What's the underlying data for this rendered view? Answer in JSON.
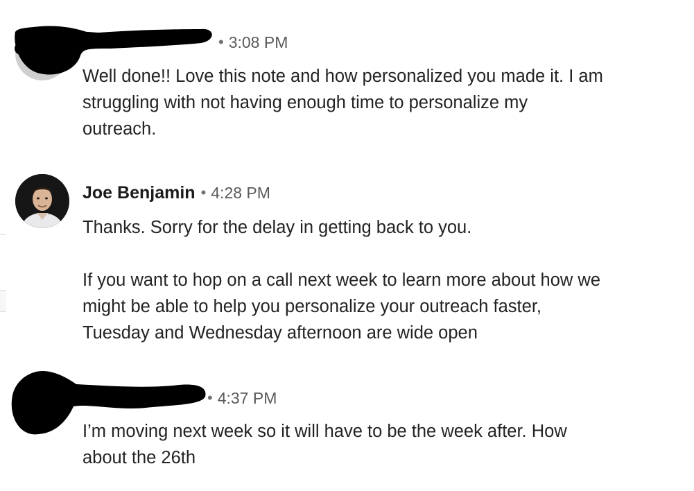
{
  "messages": [
    {
      "sender": "",
      "sender_redacted": true,
      "separator": "•",
      "time": "3:08 PM",
      "text": "Well done!! Love this note and how personalized you made it. I am\nstruggling with not having enough time to personalize my\noutreach."
    },
    {
      "sender": "Joe Benjamin",
      "sender_redacted": false,
      "separator": "•",
      "time": "4:28 PM",
      "text": "Thanks. Sorry for the delay in getting back to you.\n\nIf you want to hop on a call next week to learn more about how we\nmight be able to help you personalize your outreach faster,\nTuesday and Wednesday afternoon are wide open"
    },
    {
      "sender": "",
      "sender_redacted": true,
      "separator": "•",
      "time": "4:37 PM",
      "text": "I’m moving next week so it will have to be the week after. How\nabout the 26th"
    }
  ],
  "colors": {
    "redaction": "#000000",
    "name": "#1b1b1b",
    "timestamp": "#5a5a5a",
    "body": "#232323",
    "divider": "#dcdcdc"
  }
}
